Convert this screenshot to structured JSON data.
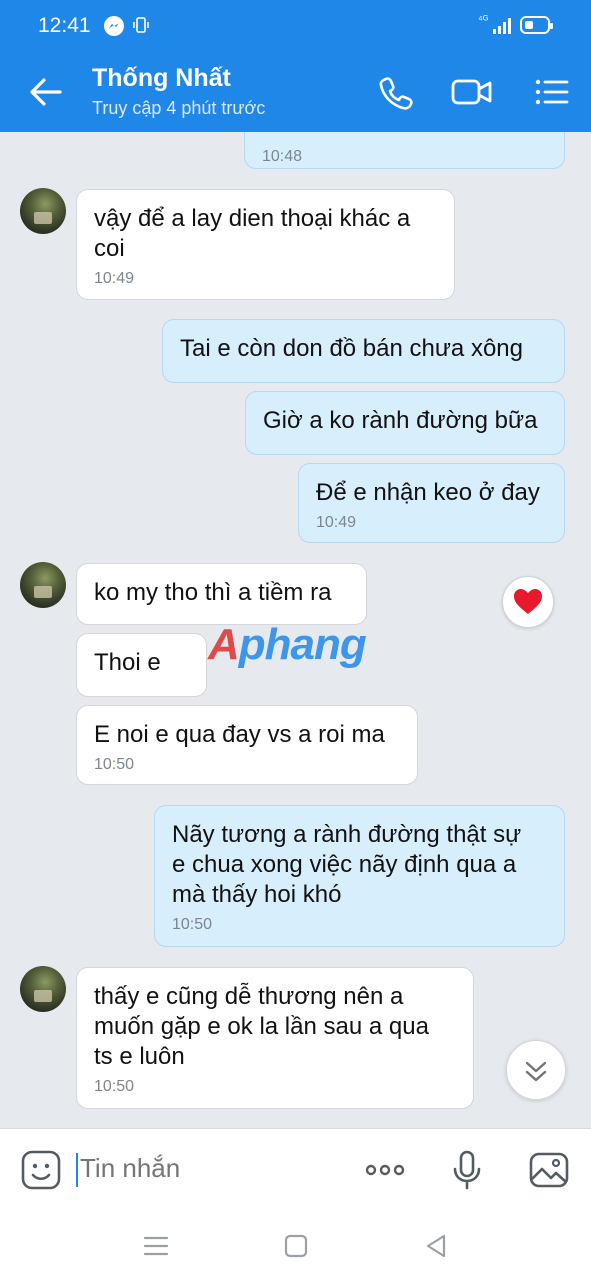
{
  "status_bar": {
    "time": "12:41",
    "signal_glyph": "⁴ᴵᴵ",
    "network": "⁴ᴳ"
  },
  "header": {
    "contact_name": "Thống Nhất",
    "last_seen": "Truy cập 4 phút trước"
  },
  "messages": [
    {
      "id": "m1",
      "side": "out",
      "text": "",
      "time": "10:48"
    },
    {
      "id": "m2",
      "side": "in",
      "text": "vậy để a lay dien thoại khác a\ncoi",
      "time": "10:49"
    },
    {
      "id": "m3",
      "side": "out",
      "text": "Tai e còn don đồ bán chưa xông",
      "time": ""
    },
    {
      "id": "m4",
      "side": "out",
      "text": "Giờ a ko rành đường bữa",
      "time": ""
    },
    {
      "id": "m5",
      "side": "out",
      "text": "Để e nhận keo ở đay",
      "time": "10:49"
    },
    {
      "id": "m6",
      "side": "in",
      "text": "ko my tho thì a tiềm ra",
      "time": "",
      "reaction": "heart"
    },
    {
      "id": "m7",
      "side": "in",
      "text": "Thoi e",
      "time": ""
    },
    {
      "id": "m8",
      "side": "in",
      "text": "E noi e qua đay vs a roi ma",
      "time": "10:50"
    },
    {
      "id": "m9",
      "side": "out",
      "text": "Nãy tương a rành đường thật sự\ne chua xong việc nãy định qua a\nmà thấy hoi khó",
      "time": "10:50"
    },
    {
      "id": "m10",
      "side": "in",
      "text": "thấy e cũng dễ thương nên a\nmuốn gặp e ok la lần sau a qua\nts e luôn",
      "time": "10:50"
    }
  ],
  "watermark": {
    "first": "A",
    "rest": "phang"
  },
  "composer": {
    "placeholder": "Tin nhắn"
  },
  "colors": {
    "brand_blue": "#1f87e8",
    "incoming_bubble": "#ffffff",
    "outgoing_bubble": "#d7effd",
    "heart": "#e8192c"
  }
}
